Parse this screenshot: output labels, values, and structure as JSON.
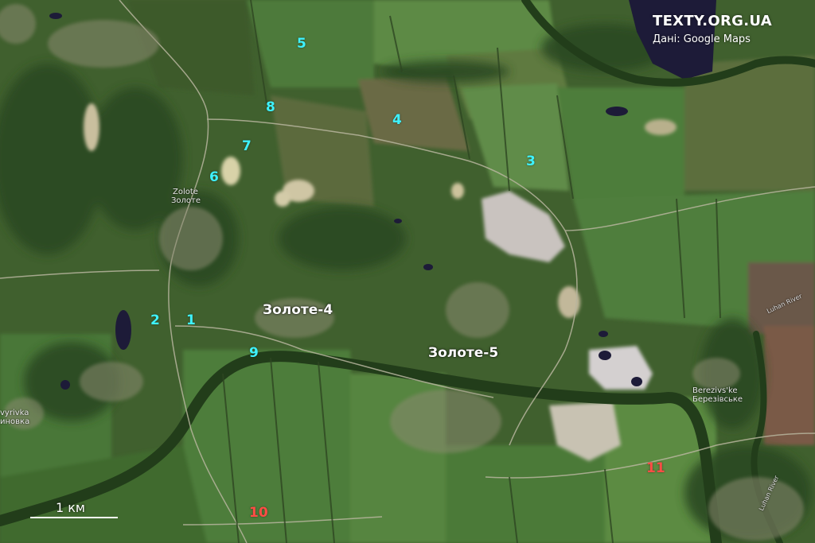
{
  "branding": {
    "site": "TEXTY.ORG.UA",
    "source": "Дані: Google Maps"
  },
  "towns": {
    "zolote4": "Золоте-4",
    "zolote5": "Золоте-5"
  },
  "places": {
    "zolote_latin": "Zolote",
    "zolote_cyr": "Золоте",
    "berezivske_latin": "Berezivs'ke",
    "berezivske_cyr": "Березівське",
    "western_latin": "vyrivka",
    "western_cyr": "иновка",
    "luhan_river": "Luhan River",
    "luhan_river_south": "Luhan River"
  },
  "markers": [
    {
      "id": "marker-1",
      "label": "1",
      "color": "cyan"
    },
    {
      "id": "marker-2",
      "label": "2",
      "color": "cyan"
    },
    {
      "id": "marker-3",
      "label": "3",
      "color": "cyan"
    },
    {
      "id": "marker-4",
      "label": "4",
      "color": "cyan"
    },
    {
      "id": "marker-5",
      "label": "5",
      "color": "cyan"
    },
    {
      "id": "marker-6",
      "label": "6",
      "color": "cyan"
    },
    {
      "id": "marker-7",
      "label": "7",
      "color": "cyan"
    },
    {
      "id": "marker-8",
      "label": "8",
      "color": "cyan"
    },
    {
      "id": "marker-9",
      "label": "9",
      "color": "cyan"
    },
    {
      "id": "marker-10",
      "label": "10",
      "color": "red"
    },
    {
      "id": "marker-11",
      "label": "11",
      "color": "red"
    }
  ],
  "scale": {
    "label": "1 км"
  },
  "colors": {
    "marker_cyan": "#3ef2ff",
    "marker_red": "#ff4d45",
    "label_white": "#ffffff"
  }
}
